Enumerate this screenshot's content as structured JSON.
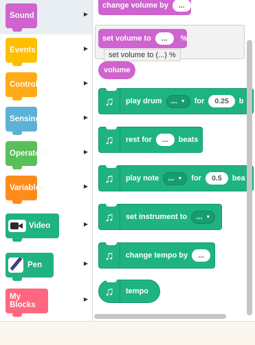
{
  "categories": [
    {
      "label": "Sound",
      "color": "#cf63cf",
      "selected": true
    },
    {
      "label": "Events",
      "color": "#ffbf00"
    },
    {
      "label": "Control",
      "color": "#ffab19"
    },
    {
      "label": "Sensing",
      "color": "#5cb1d6"
    },
    {
      "label": "Operators",
      "color": "#59c059"
    },
    {
      "label": "Variables",
      "color": "#ff8c1a"
    },
    {
      "label": "Video",
      "color": "#1fb381",
      "icon": "video-camera-icon"
    },
    {
      "label": "Pen",
      "color": "#1fb381",
      "icon": "pen-icon"
    },
    {
      "label": "My Blocks",
      "color": "#ff6680"
    }
  ],
  "sound_blocks": {
    "change_volume": {
      "label": "change volume by",
      "input": "..."
    },
    "set_volume": {
      "label": "set volume to",
      "input": "...",
      "suffix": "%"
    },
    "volume": {
      "label": "volume"
    }
  },
  "tooltip": "set volume to (...) %",
  "music_blocks": {
    "play_drum": {
      "label": "play drum",
      "dropdown": "...",
      "mid": "for",
      "input": "0.25",
      "tail": "b"
    },
    "rest_for": {
      "label": "rest for",
      "input": "...",
      "tail": "beats"
    },
    "play_note": {
      "label": "play note",
      "dropdown": "...",
      "mid": "for",
      "input": "0.5",
      "tail": "bea"
    },
    "set_instrument": {
      "label": "set instrument to",
      "dropdown": "..."
    },
    "change_tempo": {
      "label": "change tempo by",
      "input": "..."
    },
    "tempo": {
      "label": "tempo"
    }
  },
  "icons": {
    "music": "music-note-icon",
    "chevron": "chevron-right-icon"
  },
  "colors": {
    "sound": "#cf63cf",
    "music": "#1fb381",
    "selected_bg": "#e9eef2"
  }
}
